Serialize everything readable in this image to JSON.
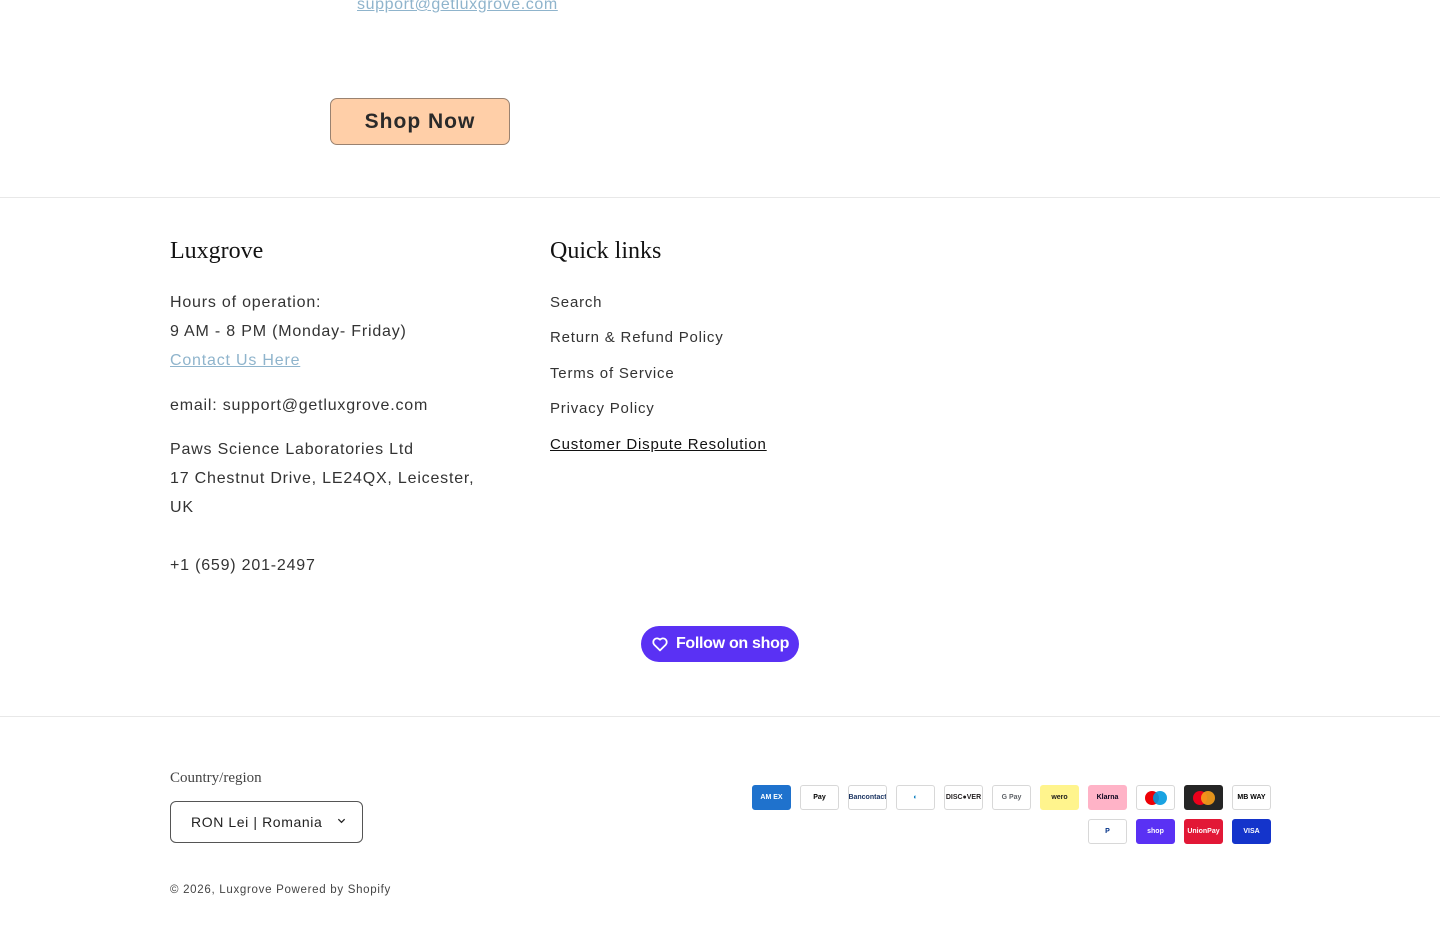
{
  "top": {
    "email_link": "support@getluxgrove.com",
    "shop_now_label": "Shop Now"
  },
  "footer": {
    "brand_title": "Luxgrove",
    "hours_label": "Hours of operation:",
    "hours_value": "9 AM - 8 PM (Monday- Friday)",
    "contact_link": "Contact Us Here",
    "email": "email: support@getluxgrove.com",
    "company": "Paws Science Laboratories Ltd",
    "address_line1": "17 Chestnut Drive, LE24QX, Leicester,",
    "address_line2": "UK",
    "phone": "+1 (659) 201-2497",
    "links_title": "Quick links",
    "links": [
      {
        "label": "Search"
      },
      {
        "label": "Return & Refund Policy"
      },
      {
        "label": "Terms of Service"
      },
      {
        "label": "Privacy Policy"
      },
      {
        "label": "Customer Dispute Resolution"
      }
    ],
    "follow_label": "Follow on shop"
  },
  "bottom": {
    "region_label": "Country/region",
    "region_value": "RON Lei | Romania",
    "copyright_prefix": "© 2026, ",
    "copyright_brand": "Luxgrove",
    "powered_by": "Powered by Shopify"
  },
  "payments": [
    {
      "name": "American Express",
      "text": "AM EX",
      "bg": "#1f72cd",
      "fg": "#ffffff"
    },
    {
      "name": "Apple Pay",
      "text": " Pay",
      "bg": "#ffffff",
      "fg": "#000000"
    },
    {
      "name": "Bancontact",
      "text": "Bancontact",
      "bg": "#ffffff",
      "fg": "#1e3764"
    },
    {
      "name": "Diners Club",
      "text": "◐",
      "bg": "#ffffff",
      "fg": "#0079be"
    },
    {
      "name": "Discover",
      "text": "DISC●VER",
      "bg": "#ffffff",
      "fg": "#231f20"
    },
    {
      "name": "Google Pay",
      "text": "G Pay",
      "bg": "#ffffff",
      "fg": "#5f6368"
    },
    {
      "name": "Wero",
      "text": "wero",
      "bg": "#fff48d",
      "fg": "#1d1c1c"
    },
    {
      "name": "Klarna",
      "text": "Klarna",
      "bg": "#ffb3c7",
      "fg": "#0b051d"
    },
    {
      "name": "Maestro",
      "text": "",
      "bg": "#ffffff",
      "fg": "#000000"
    },
    {
      "name": "Mastercard",
      "text": "",
      "bg": "#252525",
      "fg": "#ffffff"
    },
    {
      "name": "MB Way",
      "text": "MB WAY",
      "bg": "#ffffff",
      "fg": "#000000"
    },
    {
      "name": "PayPal",
      "text": "P",
      "bg": "#ffffff",
      "fg": "#003087"
    },
    {
      "name": "Shop Pay",
      "text": "shop",
      "bg": "#5a31f4",
      "fg": "#ffffff"
    },
    {
      "name": "UnionPay",
      "text": "UnionPay",
      "bg": "#e21836",
      "fg": "#ffffff"
    },
    {
      "name": "Visa",
      "text": "VISA",
      "bg": "#1434cb",
      "fg": "#ffffff"
    }
  ]
}
